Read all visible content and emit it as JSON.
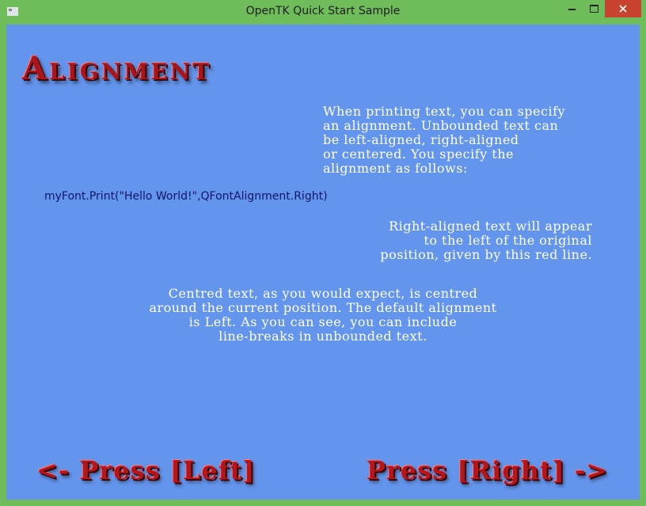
{
  "window": {
    "title": "OpenTK Quick Start Sample"
  },
  "content": {
    "heading": "Alignment",
    "intro_lines": [
      "When printing text, you can specify",
      "an alignment. Unbounded text can",
      "be left-aligned, right-aligned",
      "or centered. You specify the",
      "alignment as follows:"
    ],
    "code": "myFont.Print(\"Hello World!\",QFontAlignment.Right)",
    "right_lines": [
      "Right-aligned text will appear",
      "to the left of the original",
      "position, given by this red line."
    ],
    "center_lines": [
      "Centred text, as you would expect, is centred",
      "around the current position. The default alignment",
      "is Left. As you can see, you can include",
      "line-breaks in unbounded text."
    ],
    "nav": {
      "prev_label": "<- Press [Left]",
      "next_label": "Press [Right] ->"
    }
  },
  "colors": {
    "background": "#6495ec",
    "frame": "#6fbc5a",
    "heading_red": "#a8161c",
    "code_text": "#101566",
    "close_button": "#c7432f"
  },
  "icons": {
    "app": "app-icon",
    "minimize": "minimize-icon",
    "maximize": "maximize-icon",
    "close": "close-icon"
  }
}
